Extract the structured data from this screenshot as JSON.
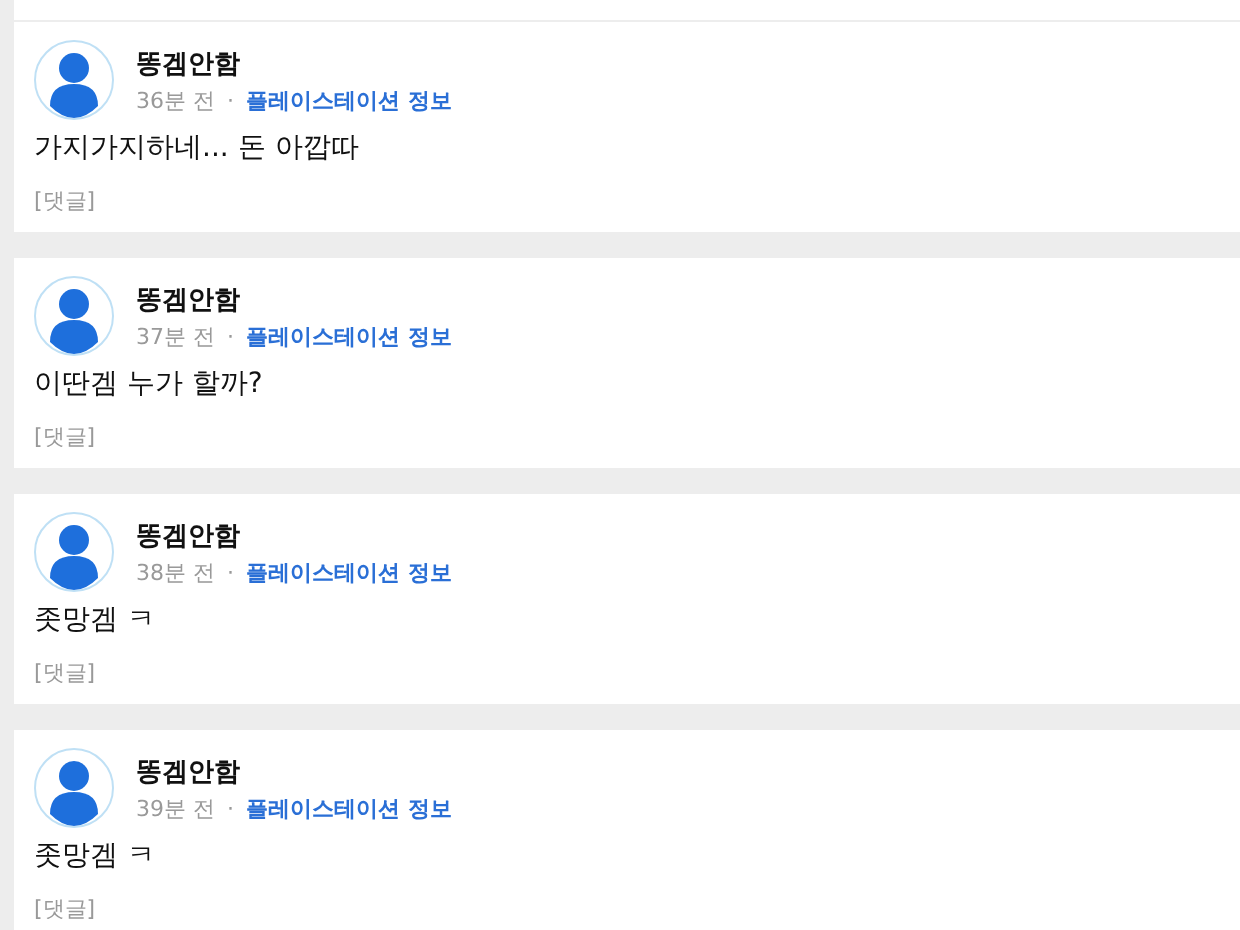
{
  "posts": [
    {
      "author": "똥겜안함",
      "time": "36분 전",
      "separator": "·",
      "source": "플레이스테이션 정보",
      "content": "가지가지하네... 돈 아깝따",
      "comment_link": "[댓글]"
    },
    {
      "author": "똥겜안함",
      "time": "37분 전",
      "separator": "·",
      "source": "플레이스테이션 정보",
      "content": "이딴겜 누가 할까?",
      "comment_link": "[댓글]"
    },
    {
      "author": "똥겜안함",
      "time": "38분 전",
      "separator": "·",
      "source": "플레이스테이션 정보",
      "content": "좃망겜 ㅋ",
      "comment_link": "[댓글]"
    },
    {
      "author": "똥겜안함",
      "time": "39분 전",
      "separator": "·",
      "source": "플레이스테이션 정보",
      "content": "좃망겜 ㅋ",
      "comment_link": "[댓글]"
    }
  ]
}
